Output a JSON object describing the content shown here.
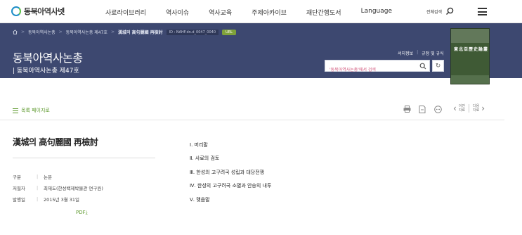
{
  "header": {
    "logo_text": "동북아역사넷",
    "menu": [
      "사료라이브러리",
      "역사이슈",
      "역사교육",
      "주제아카이브",
      "재단간행도서",
      "Language"
    ],
    "all_search_label": "전체검색"
  },
  "banner": {
    "breadcrumb": [
      "동북아역사논총",
      "동북아역사논총 제47호",
      "漢城의 高句麗國 再檢討"
    ],
    "id_text": "ID : NAHF.dn.d_0047_0040",
    "url_label": "URL",
    "title": "동북아역사논총",
    "subtitle": "| 동북아역사논총 제47호",
    "links": [
      "서지정보",
      "규정 및 규식"
    ],
    "search_placeholder": "'동북아역사논총'에서 검색",
    "cover_title": "東北亞歷史論叢"
  },
  "toolbar": {
    "toc_label": "목록 페이지로",
    "prev_label": [
      "이전",
      "자료"
    ],
    "next_label": [
      "다음",
      "자료"
    ]
  },
  "article": {
    "title": "漢城의 高句麗國 再檢討",
    "meta": [
      {
        "key": "구분",
        "value": "논문"
      },
      {
        "key": "저필자",
        "value": "최재도(한성백제박물관 연구원)"
      },
      {
        "key": "발행일",
        "value": "2015년 3월 31일"
      }
    ],
    "pdf_label": "PDF"
  },
  "toc": [
    "Ⅰ. 머리말",
    "Ⅱ. 사료의 검토",
    "Ⅲ. 한성의 고구려국 성립과 대당전쟁",
    "Ⅳ. 한성의 고구려국 소멸과 안승의 내투",
    "Ⅴ. 맺음말"
  ],
  "colors": {
    "banner_bg": "#3d4870",
    "accent_green": "#5e9a2e",
    "url_badge": "#7fa23a"
  }
}
